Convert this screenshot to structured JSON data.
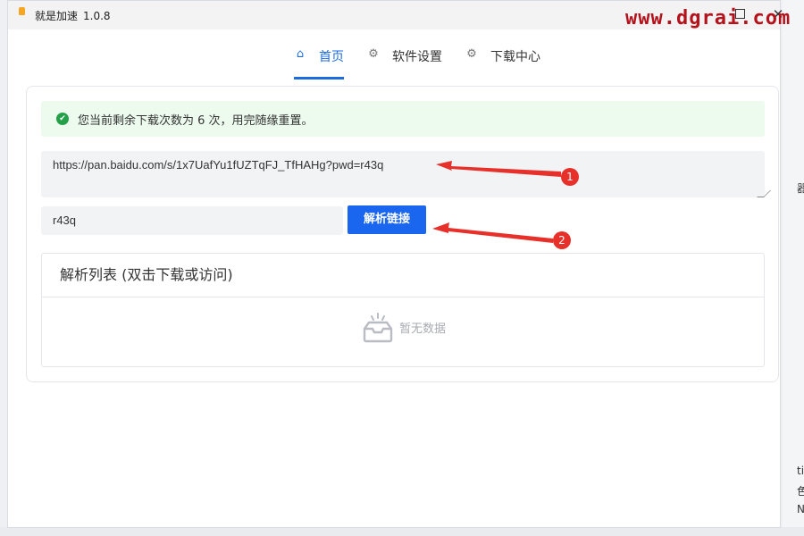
{
  "window": {
    "title": "就是加速",
    "version": "1.0.8",
    "watermark": "www.dgrai.com",
    "maximize_icon": "maximize-icon",
    "close_icon": "close-icon"
  },
  "nav": {
    "tabs": [
      {
        "label": "首页",
        "icon": "home-icon",
        "active": true
      },
      {
        "label": "软件设置",
        "icon": "gear-icon",
        "active": false
      },
      {
        "label": "下载中心",
        "icon": "gear-icon",
        "active": false
      }
    ],
    "accent": "#1e6be0"
  },
  "alert": {
    "message": "您当前剩余下载次数为 6 次，用完随缘重置。",
    "icon": "check-circle-icon",
    "color": "#24a148"
  },
  "form": {
    "url_value": "https://pan.baidu.com/s/1x7UafYu1fUZTqFJ_TfHAHg?pwd=r43q",
    "password_value": "r43q",
    "parse_button": "解析链接",
    "button_color": "#1a66ee"
  },
  "list": {
    "header": "解析列表 (双击下载或访问)",
    "empty_text": "暂无数据",
    "empty_icon": "empty-inbox-icon"
  },
  "annotations": {
    "badge_1": "1",
    "badge_2": "2",
    "color": "#e8302a"
  },
  "background": {
    "frag_1": "器",
    "frag_2": "ti",
    "frag_3": "色",
    "frag_4": "N"
  }
}
